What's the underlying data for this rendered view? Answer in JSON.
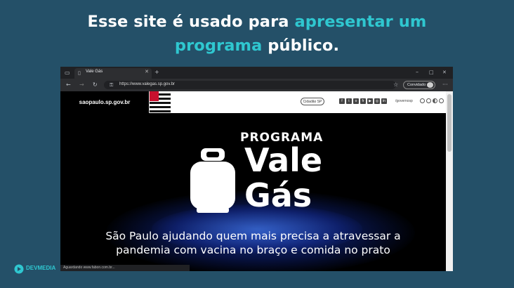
{
  "headline": {
    "part1": "Esse site é usado para ",
    "accent1": "apresentar um",
    "accent2": "programa",
    "part2": " público."
  },
  "colors": {
    "accent": "#2fc7d0",
    "background": "#245068"
  },
  "browser": {
    "tab_title": "Vale Gás",
    "url": "https://www.valegas.sp.gov.br",
    "guest_label": "Convidado",
    "status_text": "Aguardando www.fabon.com.br..."
  },
  "site": {
    "logo_text": "saopaulo.sp.gov.br",
    "cidadao_label": "Cidadão SP",
    "social": [
      "f",
      "t",
      "o",
      "fr",
      "▶",
      "◎",
      "in"
    ],
    "handle": "/governosp",
    "program_label": "PROGRAMA",
    "title_line1": "Vale",
    "title_line2": "Gás",
    "tagline_line1": "São Paulo ajudando quem mais precisa a atravessar a",
    "tagline_line2": "pandemia com vacina no braço e comida no prato"
  },
  "brand": {
    "name": "DEVMEDIA"
  },
  "icons": [
    "sidebar-icon",
    "page-icon",
    "close-icon",
    "new-tab-icon",
    "minimize-icon",
    "maximize-icon",
    "window-close-icon",
    "back-icon",
    "forward-icon",
    "refresh-icon",
    "lock-icon",
    "favorites-icon",
    "more-icon",
    "gas-cylinder-icon",
    "devmedia-logo-icon"
  ]
}
